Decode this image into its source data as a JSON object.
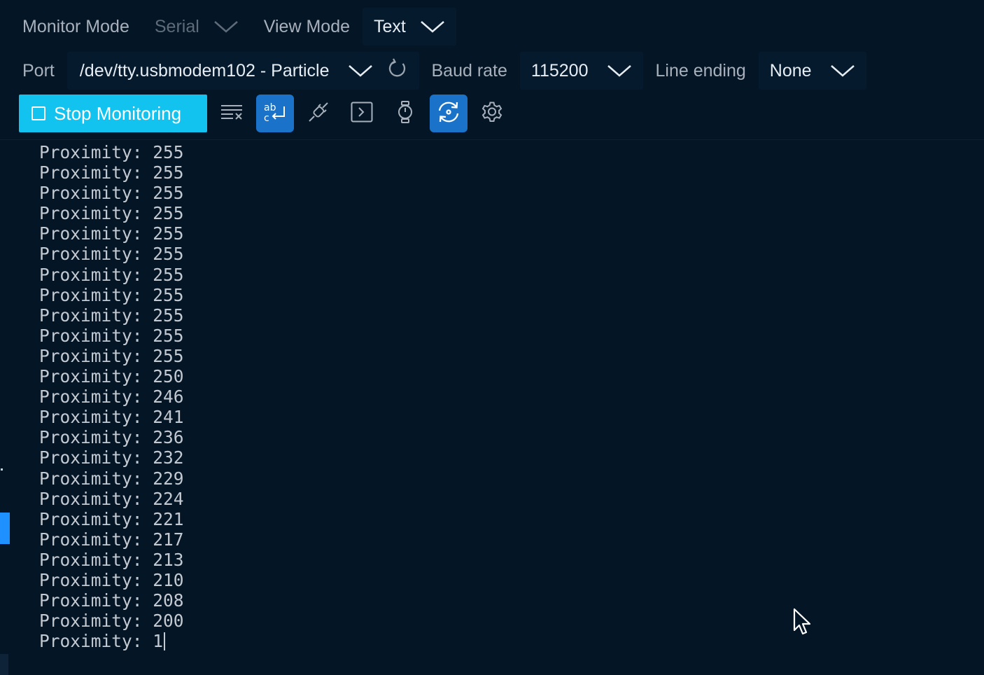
{
  "monitor_mode": {
    "label": "Monitor Mode",
    "value": "Serial"
  },
  "view_mode": {
    "label": "View Mode",
    "value": "Text"
  },
  "port": {
    "label": "Port",
    "value": "/dev/tty.usbmodem102 - Particle"
  },
  "baud_rate": {
    "label": "Baud rate",
    "value": "115200"
  },
  "line_ending": {
    "label": "Line ending",
    "value": "None"
  },
  "toolbar": {
    "stop_label": "Stop Monitoring",
    "icons": [
      "clear-output-icon",
      "word-wrap-icon",
      "connect-plug-icon",
      "terminal-icon",
      "timestamp-stopwatch-icon",
      "auto-reconnect-icon",
      "settings-gear-icon"
    ],
    "active_icons": [
      "word-wrap-icon",
      "auto-reconnect-icon"
    ]
  },
  "output": {
    "lines": [
      "Proximity: 255",
      "Proximity: 255",
      "Proximity: 255",
      "Proximity: 255",
      "Proximity: 255",
      "Proximity: 255",
      "Proximity: 255",
      "Proximity: 255",
      "Proximity: 255",
      "Proximity: 255",
      "Proximity: 255",
      "Proximity: 250",
      "Proximity: 246",
      "Proximity: 241",
      "Proximity: 236",
      "Proximity: 232",
      "Proximity: 229",
      "Proximity: 224",
      "Proximity: 221",
      "Proximity: 217",
      "Proximity: 213",
      "Proximity: 210",
      "Proximity: 208",
      "Proximity: 200"
    ],
    "partial_line": "Proximity: 1"
  },
  "colors": {
    "background": "#041526",
    "accent_button": "#12c3ef",
    "active_toggle": "#1a73c8",
    "side_marker": "#1e90ff"
  }
}
